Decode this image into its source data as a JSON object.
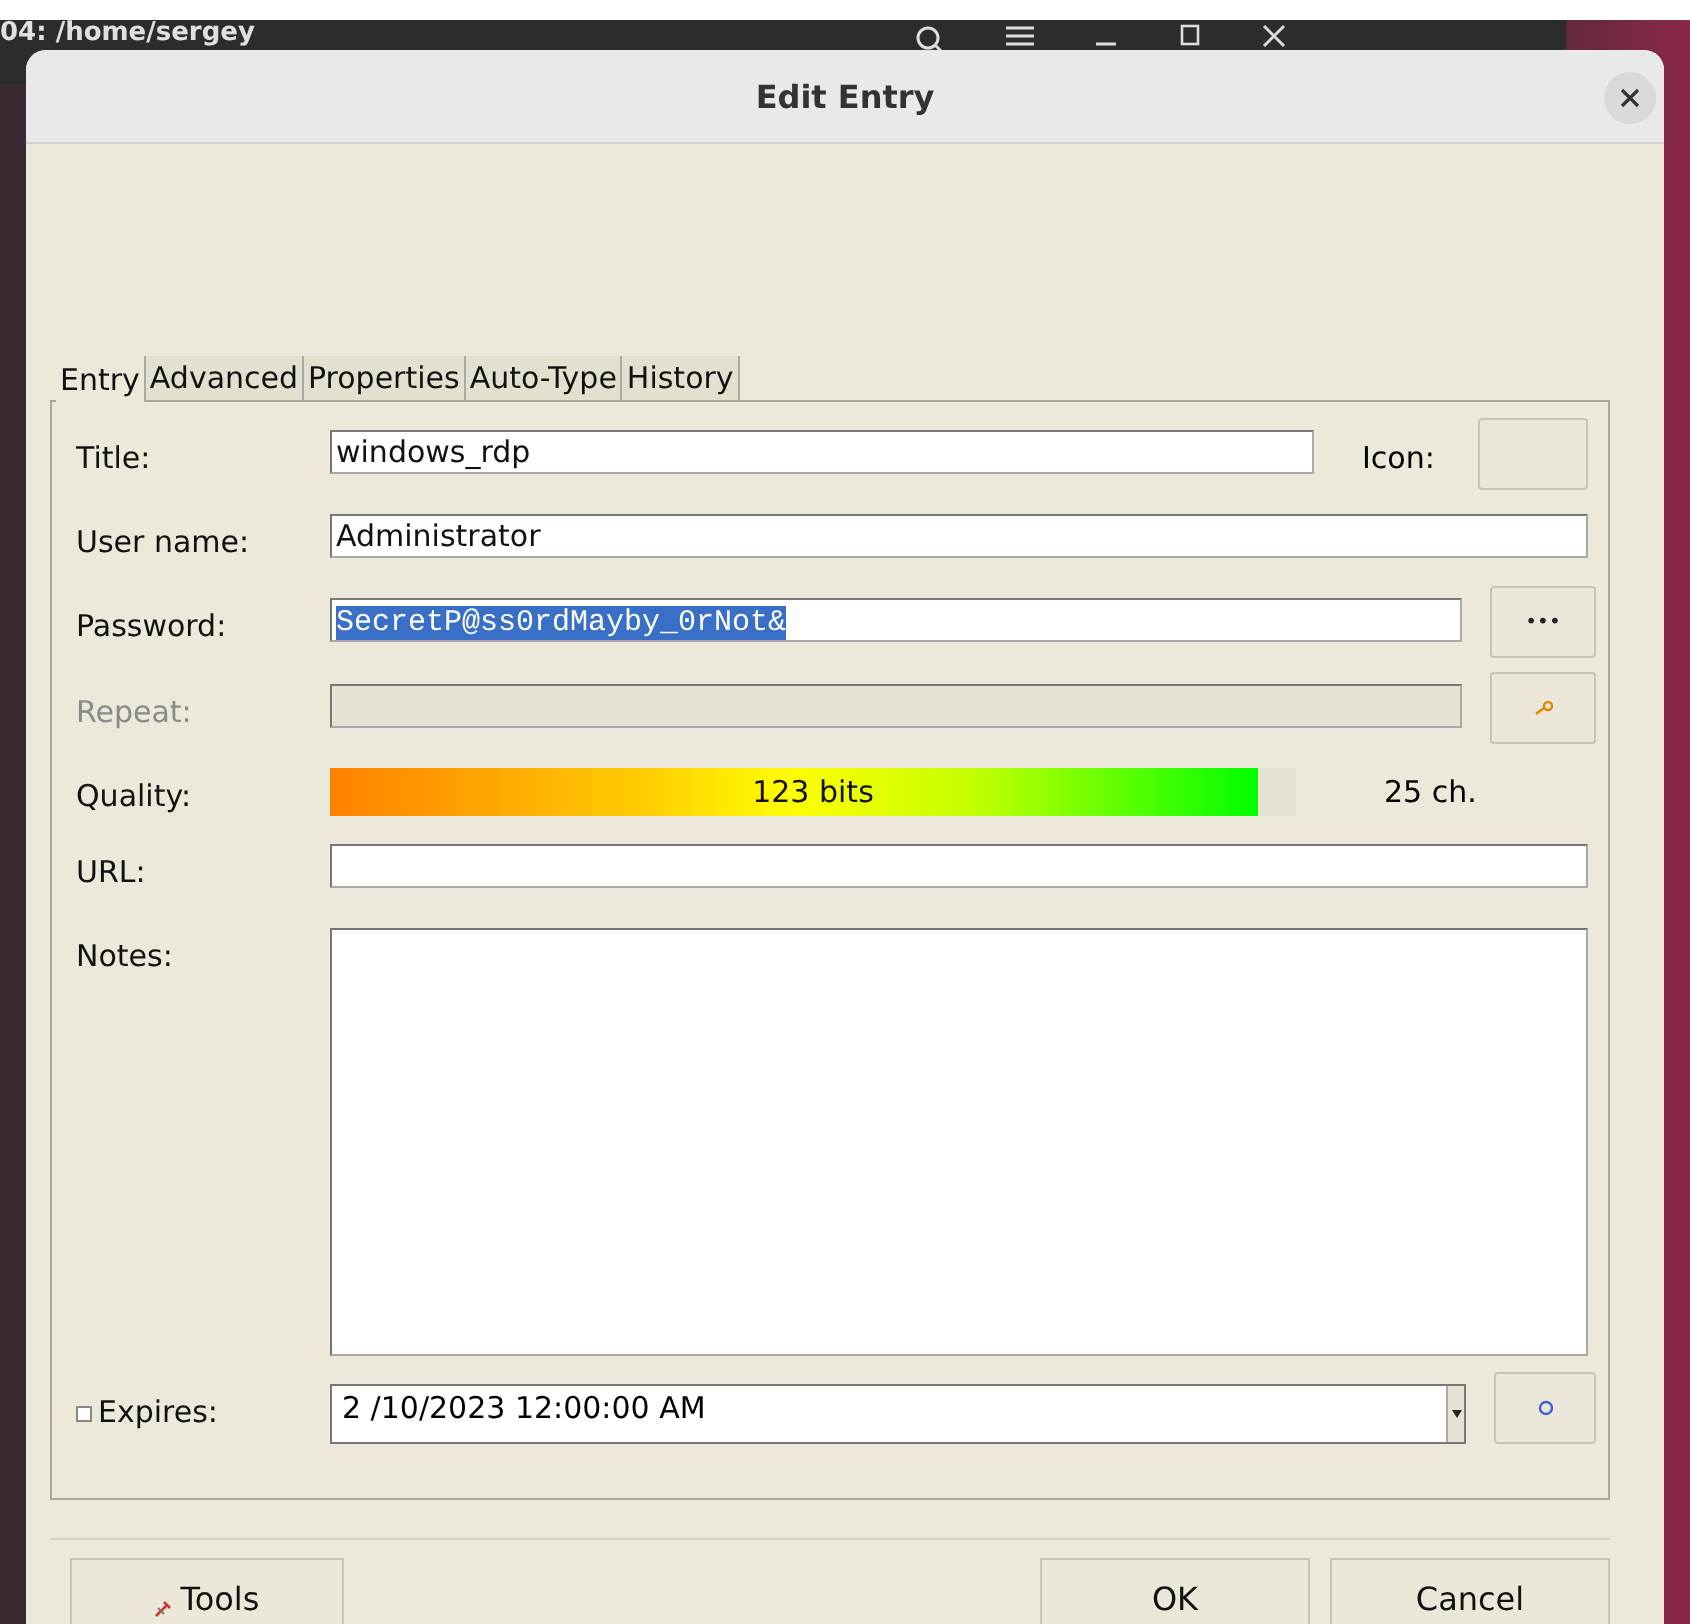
{
  "terminal": {
    "title": "04: /home/sergey"
  },
  "dialog": {
    "title": "Edit Entry",
    "tabs": [
      {
        "label": "Entry",
        "selected": true
      },
      {
        "label": "Advanced",
        "selected": false
      },
      {
        "label": "Properties",
        "selected": false
      },
      {
        "label": "Auto-Type",
        "selected": false
      },
      {
        "label": "History",
        "selected": false
      }
    ],
    "fields": [
      {
        "kind": "title",
        "label": "Title:",
        "value": "windows_rdp",
        "side_label": "Icon:"
      },
      {
        "kind": "text",
        "label": "User name:",
        "value": "Administrator"
      },
      {
        "kind": "password",
        "label": "Password:",
        "value": "SecretP@ss0rdMayby_0rNot&",
        "selected": true,
        "button": "•••"
      },
      {
        "kind": "repeat",
        "label": "Repeat:",
        "disabled": true
      },
      {
        "kind": "quality",
        "label": "Quality:",
        "level": 0.96,
        "reading": "123 bits",
        "count": "25 ch."
      },
      {
        "kind": "text",
        "label": "URL:"
      },
      {
        "kind": "notes",
        "label": "Notes:"
      },
      {
        "kind": "expires",
        "label": "Expires:",
        "checked": false,
        "value": "2 /10/2023 12:00:00 AM"
      }
    ],
    "buttons": [
      {
        "kind": "tools",
        "label": "Tools"
      },
      {
        "kind": "ok",
        "label": "OK"
      },
      {
        "kind": "cancel",
        "label": "Cancel"
      }
    ]
  }
}
